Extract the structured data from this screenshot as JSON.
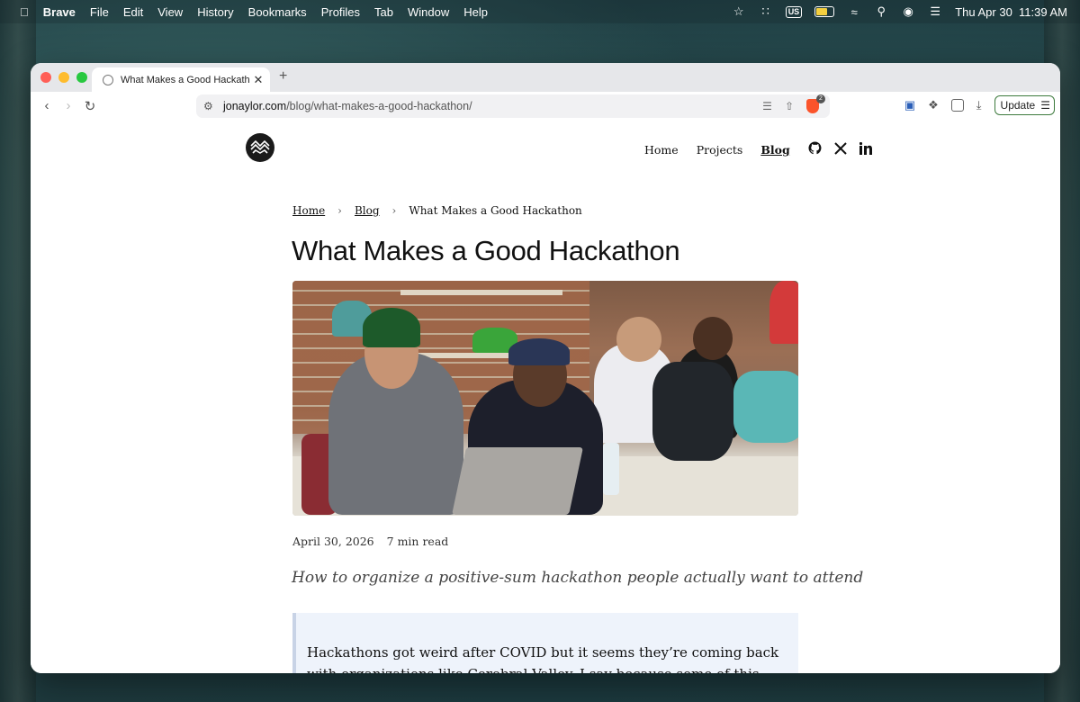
{
  "menubar": {
    "app": "Brave",
    "items": [
      "File",
      "Edit",
      "View",
      "History",
      "Bookmarks",
      "Profiles",
      "Tab",
      "Window",
      "Help"
    ],
    "input_source": "US",
    "datetime": "Thu Apr 30  11:39 AM"
  },
  "browser": {
    "tab": {
      "title": "What Makes a Good Hackathon"
    },
    "url": {
      "host": "jonaylor.com",
      "path": "/blog/what-makes-a-good-hackathon/"
    },
    "shield_count": "2",
    "update_label": "Update",
    "colors": {
      "close": "#ff5f57",
      "minimize": "#febc2e",
      "zoom": "#28c840",
      "update_border": "#3d7a3d"
    }
  },
  "site": {
    "nav": {
      "home": "Home",
      "projects": "Projects",
      "blog": "Blog"
    },
    "breadcrumbs": {
      "home": "Home",
      "blog": "Blog",
      "current": "What Makes a Good Hackathon"
    },
    "title": "What Makes a Good Hackathon",
    "meta": {
      "date": "April 30, 2026",
      "read_time": "7 min read"
    },
    "subtitle": "How to organize a positive-sum hackathon people actually want to attend",
    "callout_text": "Hackathons got weird after COVID but it seems they’re coming back with organizations like Cerebral Valley. I say because some of this information"
  }
}
